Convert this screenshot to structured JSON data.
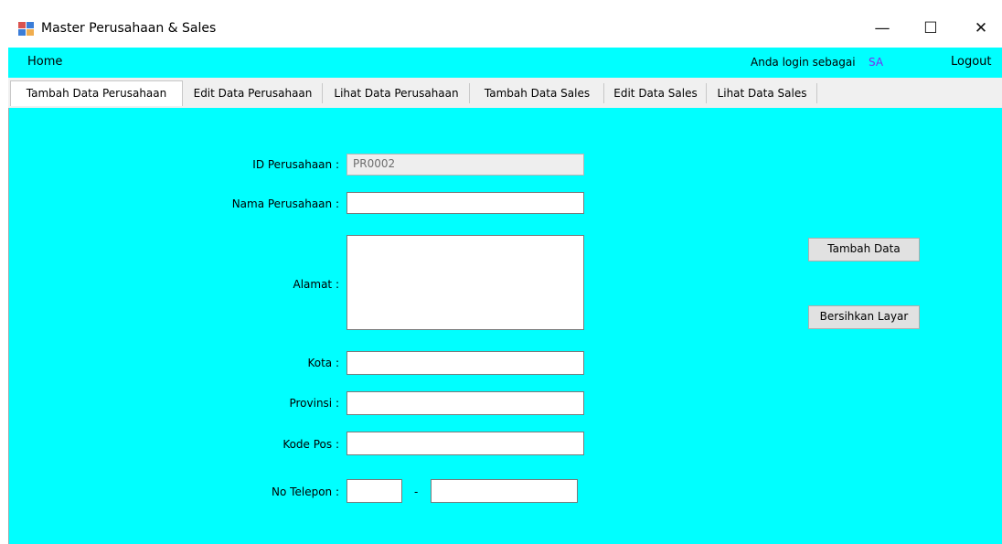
{
  "window": {
    "title": "Master Perusahaan & Sales",
    "controls": {
      "minimize": "—",
      "maximize": "☐",
      "close": "✕"
    }
  },
  "menu": {
    "home": "Home",
    "login_label": "Anda login sebagai",
    "login_user": "SA",
    "logout": "Logout"
  },
  "tabs": [
    {
      "label": "Tambah Data Perusahaan",
      "active": true
    },
    {
      "label": "Edit Data Perusahaan",
      "active": false
    },
    {
      "label": "Lihat Data Perusahaan",
      "active": false
    },
    {
      "label": "Tambah Data Sales",
      "active": false
    },
    {
      "label": "Edit Data Sales",
      "active": false
    },
    {
      "label": "Lihat Data Sales",
      "active": false
    }
  ],
  "form": {
    "id_perusahaan": {
      "label": "ID Perusahaan :",
      "value": "PR0002"
    },
    "nama_perusahaan": {
      "label": "Nama Perusahaan :",
      "value": ""
    },
    "alamat": {
      "label": "Alamat :",
      "value": ""
    },
    "kota": {
      "label": "Kota :",
      "value": ""
    },
    "provinsi": {
      "label": "Provinsi :",
      "value": ""
    },
    "kode_pos": {
      "label": "Kode Pos :",
      "value": ""
    },
    "no_telepon": {
      "label": "No Telepon :",
      "area_value": "",
      "number_value": "",
      "separator": "-"
    }
  },
  "buttons": {
    "tambah": "Tambah Data",
    "bersihkan": "Bersihkan Layar"
  },
  "colors": {
    "background": "#00ffff",
    "login_user": "#7b2cf0"
  }
}
